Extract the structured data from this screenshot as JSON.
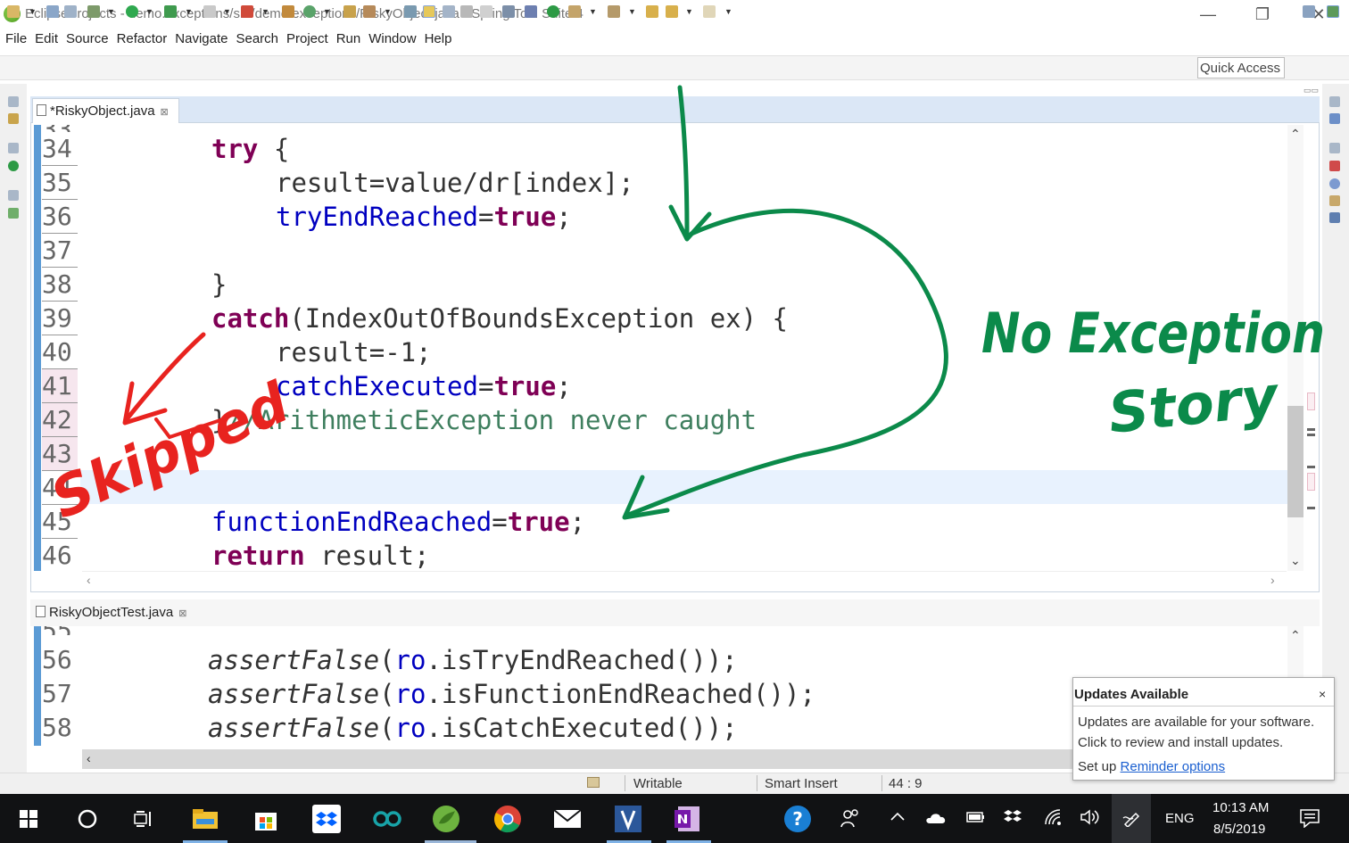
{
  "window": {
    "title": "EclipseProjects - demo.exceptions/src/demo/exceptions/RiskyObject.java - Spring Tool Suite 4",
    "minimize_glyph": "—",
    "restore_glyph": "❐",
    "close_glyph": "✕"
  },
  "menu": [
    "File",
    "Edit",
    "Source",
    "Refactor",
    "Navigate",
    "Search",
    "Project",
    "Run",
    "Window",
    "Help"
  ],
  "toolbar": {
    "quick_access": "Quick Access"
  },
  "editor1": {
    "tab_label": "*RiskyObject.java",
    "tab_close": "⊠",
    "partial_top_line": "33",
    "lines": [
      {
        "no": "34",
        "text": "try {"
      },
      {
        "no": "35",
        "text": "result=value/dr[index];"
      },
      {
        "no": "36",
        "text": "tryEndReached=true;"
      },
      {
        "no": "37",
        "text": ""
      },
      {
        "no": "38",
        "text": "}"
      },
      {
        "no": "39",
        "text": "catch(IndexOutOfBoundsException ex) {"
      },
      {
        "no": "40",
        "text": "result=-1;"
      },
      {
        "no": "41",
        "text": "catchExecuted=true;"
      },
      {
        "no": "42",
        "text": "}//ArithmeticException never caught"
      },
      {
        "no": "43",
        "text": ""
      },
      {
        "no": "44",
        "text": ""
      },
      {
        "no": "45",
        "text": "functionEndReached=true;"
      },
      {
        "no": "46",
        "text": "return result;"
      }
    ],
    "tokens": {
      "try": "try",
      "brace_open": " {",
      "result_assign": "result=value/dr[index];",
      "tryEndReached": "tryEndReached",
      "eq": "=",
      "true": "true",
      "semi": ";",
      "close_brace": "}",
      "catch": "catch",
      "catch_params": "(IndexOutOfBoundsException ex) {",
      "result_neg": "result=-1;",
      "catchExecuted": "catchExecuted",
      "comment": "//ArithmeticException never caught",
      "functionEndReached": "functionEndReached",
      "return": "return",
      "return_rest": " result;"
    }
  },
  "editor2": {
    "tab_label": "RiskyObjectTest.java",
    "tab_close": "⊠",
    "partial_top_line": "55",
    "lines": [
      {
        "no": "56",
        "call": "assertFalse",
        "open": "(",
        "obj": "ro",
        "rest": ".isTryEndReached());"
      },
      {
        "no": "57",
        "call": "assertFalse",
        "open": "(",
        "obj": "ro",
        "rest": ".isFunctionEndReached());"
      },
      {
        "no": "58",
        "call": "assertFalse",
        "open": "(",
        "obj": "ro",
        "rest": ".isCatchExecuted());"
      }
    ]
  },
  "statusbar": {
    "writable": "Writable",
    "insert_mode": "Smart Insert",
    "position": "44 : 9"
  },
  "updates_popup": {
    "title": "Updates Available",
    "close": "×",
    "line1": "Updates are available for your software.",
    "line2": "Click to review and install updates.",
    "setup_prefix": "Set up",
    "link": "Reminder options"
  },
  "annotations": {
    "red_note": "Skipped",
    "green_note_line1": "No Exception",
    "green_note_line2": "Story",
    "red_color": "#e8231f",
    "green_color": "#0b8a4a"
  },
  "taskbar": {
    "time": "10:13 AM",
    "date": "8/5/2019",
    "language": "ENG"
  },
  "colors": {
    "keyword": "#7f0055",
    "field": "#0000c0",
    "comment": "#3f7f5f",
    "current_line": "#e8f2fe",
    "tab_bar": "#dbe7f6"
  }
}
